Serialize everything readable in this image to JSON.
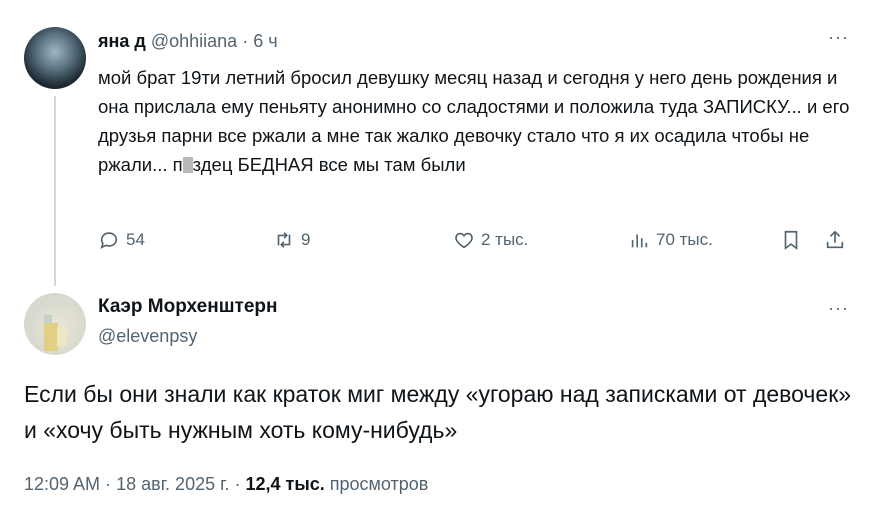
{
  "parent_tweet": {
    "author_name": "яна д",
    "author_handle": "@ohhiiana",
    "separator": "·",
    "time_ago": "6 ч",
    "text_before_censor": "мой брат 19ти летний бросил девушку месяц назад и сегодня у него день рождения и она прислала ему пеньяту анонимно со сладостями и положила туда ЗАПИСКУ... и его друзья парни все ржали а мне так жалко девочку стало что я их осадила чтобы не ржали... п",
    "text_after_censor": "здец БЕДНАЯ все мы там были",
    "more_label": "···",
    "actions": {
      "replies": "54",
      "reposts": "9",
      "likes": "2 тыс.",
      "views": "70 тыс."
    }
  },
  "main_tweet": {
    "author_name": "Каэр Морхенштерн",
    "author_handle": "@elevenpsy",
    "more_label": "···",
    "text": "Если бы они знали как краток миг между «угораю над записками от девочек» и «хочу быть нужным хоть кому-нибудь»",
    "time": "12:09 AM",
    "separator": "·",
    "date": "18 авг. 2025 г.",
    "views_count": "12,4 тыс.",
    "views_label": "просмотров"
  },
  "colors": {
    "text": "#0f1419",
    "secondary": "#536471",
    "thread_line": "#cfd9de"
  }
}
